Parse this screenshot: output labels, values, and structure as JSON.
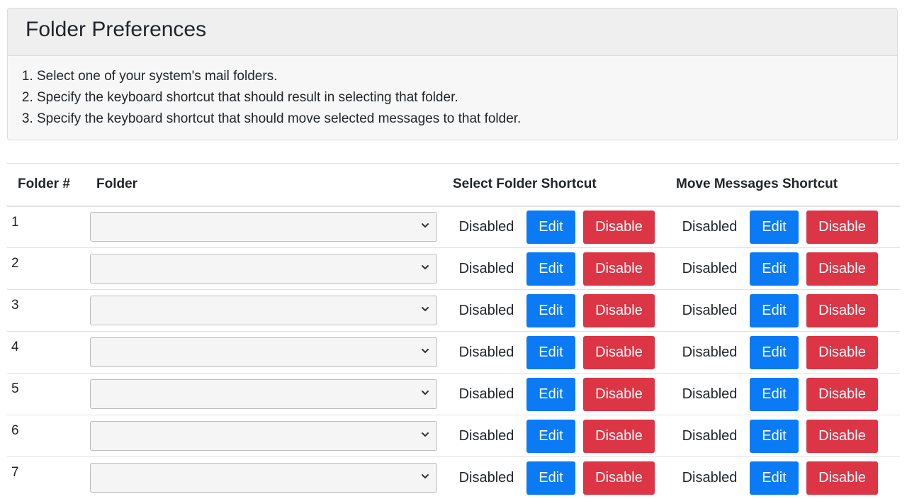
{
  "card": {
    "title": "Folder Preferences",
    "steps": [
      "Select one of your system's mail folders.",
      "Specify the keyboard shortcut that should result in selecting that folder.",
      "Specify the keyboard shortcut that should move selected messages to that folder."
    ]
  },
  "table": {
    "headers": {
      "folder_num": "Folder #",
      "folder": "Folder",
      "select_shortcut": "Select Folder Shortcut",
      "move_shortcut": "Move Messages Shortcut"
    },
    "rows": [
      {
        "num": "1",
        "folder": "",
        "select_status": "Disabled",
        "move_status": "Disabled"
      },
      {
        "num": "2",
        "folder": "",
        "select_status": "Disabled",
        "move_status": "Disabled"
      },
      {
        "num": "3",
        "folder": "",
        "select_status": "Disabled",
        "move_status": "Disabled"
      },
      {
        "num": "4",
        "folder": "",
        "select_status": "Disabled",
        "move_status": "Disabled"
      },
      {
        "num": "5",
        "folder": "",
        "select_status": "Disabled",
        "move_status": "Disabled"
      },
      {
        "num": "6",
        "folder": "",
        "select_status": "Disabled",
        "move_status": "Disabled"
      },
      {
        "num": "7",
        "folder": "",
        "select_status": "Disabled",
        "move_status": "Disabled"
      }
    ]
  },
  "buttons": {
    "edit_label": "Edit",
    "disable_label": "Disable"
  },
  "colors": {
    "edit": "#0a7bf5",
    "disable": "#dc3545"
  },
  "icons": {
    "select_arrow": "chevron-down-icon"
  }
}
